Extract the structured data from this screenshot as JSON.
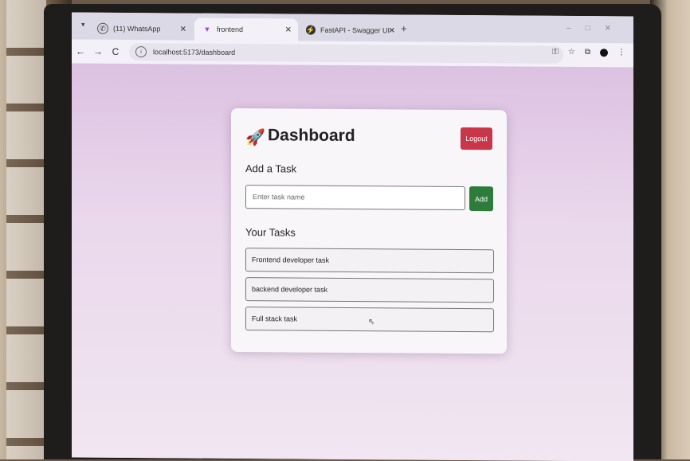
{
  "browser": {
    "tabs": [
      {
        "label": "(11) WhatsApp",
        "icon": "whatsapp-icon"
      },
      {
        "label": "frontend",
        "icon": "vite-icon"
      },
      {
        "label": "FastAPI - Swagger UI",
        "icon": "fastapi-icon"
      }
    ],
    "url": "localhost:5173/dashboard"
  },
  "dashboard": {
    "title": "Dashboard",
    "logout_label": "Logout",
    "add_section_title": "Add a Task",
    "task_input_placeholder": "Enter task name",
    "add_label": "Add",
    "tasks_section_title": "Your Tasks",
    "tasks": [
      "Frontend developer task",
      "backend developer task",
      "Full stack task"
    ]
  },
  "colors": {
    "logout": "#c9364a",
    "add": "#2e7c3c",
    "page_bg": "#e4cde6"
  }
}
